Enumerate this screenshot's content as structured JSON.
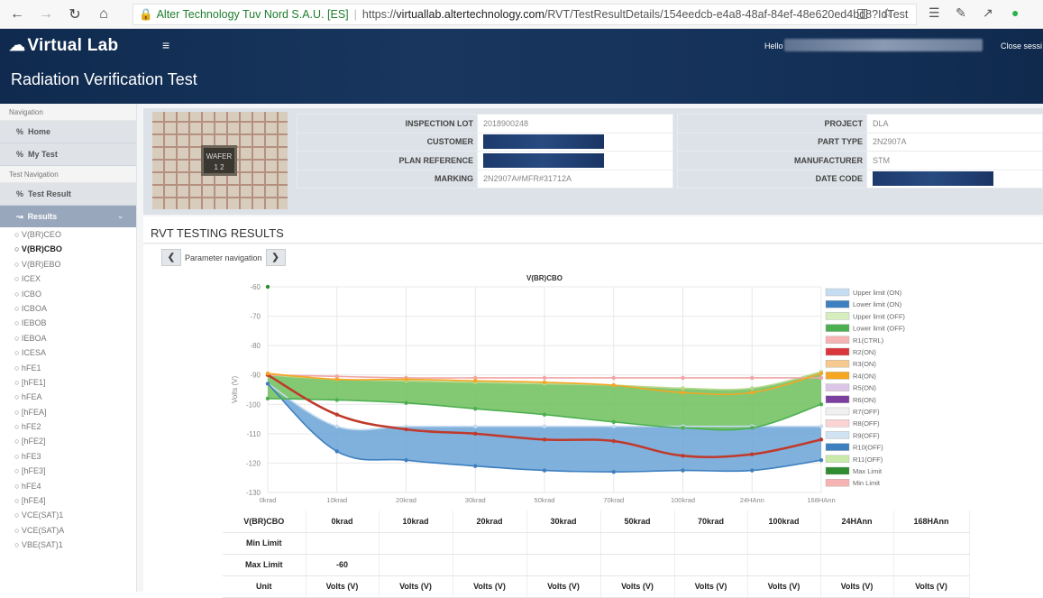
{
  "browser": {
    "site_name": "Alter Technology Tuv Nord S.A.U. [ES]",
    "url_prefix": "https://",
    "url_host": "virtuallab.altertechnology.com",
    "url_path": "/RVT/TestResultDetails/154eedcb-e4a8-48af-84ef-48e620ed4bd8?IdTest"
  },
  "app": {
    "logo": "Virtual Lab",
    "page_title": "Radiation Verification Test",
    "hello": "Hello",
    "close_session": "Close sessi"
  },
  "sidebar": {
    "navigation_label": "Navigation",
    "home": "Home",
    "my_test": "My Test",
    "test_navigation_label": "Test Navigation",
    "test_result": "Test Result",
    "results": "Results",
    "params": [
      "V(BR)CEO",
      "V(BR)CBO",
      "V(BR)EBO",
      "ICEX",
      "ICBO",
      "ICBOA",
      "IEBOB",
      "IEBOA",
      "ICESA",
      "hFE1",
      "[hFE1]",
      "hFEA",
      "[hFEA]",
      "hFE2",
      "[hFE2]",
      "hFE3",
      "[hFE3]",
      "hFE4",
      "[hFE4]",
      "VCE(SAT)1",
      "VCE(SAT)A",
      "VBE(SAT)1"
    ],
    "active_param": "V(BR)CBO"
  },
  "info": {
    "sample_label": "WAFER 1 2",
    "left": [
      {
        "label": "INSPECTION LOT",
        "value": "2018900248"
      },
      {
        "label": "CUSTOMER",
        "value": ""
      },
      {
        "label": "PLAN REFERENCE",
        "value": ""
      },
      {
        "label": "MARKING",
        "value": "2N2907A#MFR#31712A"
      }
    ],
    "right": [
      {
        "label": "PROJECT",
        "value": "DLA"
      },
      {
        "label": "PART TYPE",
        "value": "2N2907A"
      },
      {
        "label": "MANUFACTURER",
        "value": "STM"
      },
      {
        "label": "DATE CODE",
        "value": ""
      }
    ]
  },
  "results": {
    "title": "RVT TESTING RESULTS",
    "param_nav_label": "Parameter navigation"
  },
  "colors": {
    "header_bg": "#15325a",
    "sidebar_results_bg": "#98a7bb",
    "upper_on": "#c6dcf0",
    "lower_on": "#3d7fc0",
    "upper_off": "#d6eebb",
    "lower_off": "#4caf50",
    "max_limit": "#2e8b2e",
    "min_limit": "#f6b3b3"
  },
  "chart_data": {
    "type": "area",
    "title": "V(BR)CBO",
    "ylabel": "Volts (V)",
    "xlabel": "",
    "x": [
      "0krad",
      "10krad",
      "20krad",
      "30krad",
      "50krad",
      "70krad",
      "100krad",
      "24HAnn",
      "168HAnn"
    ],
    "ylim": [
      -130,
      -60
    ],
    "yticks": [
      -60,
      -70,
      -80,
      -90,
      -100,
      -110,
      -120,
      -130
    ],
    "grid": true,
    "legend_position": "right",
    "legend": [
      "Upper limit (ON)",
      "Lower limit (ON)",
      "Upper limit (OFF)",
      "Lower limit (OFF)",
      "R1(CTRL)",
      "R2(ON)",
      "R3(ON)",
      "R4(ON)",
      "R5(ON)",
      "R6(ON)",
      "R7(OFF)",
      "R8(OFF)",
      "R9(OFF)",
      "R10(OFF)",
      "R11(OFF)",
      "Max Limit",
      "Min Limit"
    ],
    "legend_colors": [
      "#c6dcf0",
      "#3d7fc0",
      "#d6eebb",
      "#4caf50",
      "#f6b3b3",
      "#d9363e",
      "#f6c98f",
      "#f5a623",
      "#dcc6e6",
      "#7b3fa0",
      "#f0f0f0",
      "#fbd3d3",
      "#cfe3f3",
      "#3d7fc0",
      "#c9eaa8",
      "#2e8b2e",
      "#f6b3b3"
    ],
    "series": [
      {
        "name": "Upper limit (ON)",
        "values": [
          -93,
          -107.5,
          -107.5,
          -107.5,
          -107.5,
          -107.5,
          -107.5,
          -107.5,
          -107.5
        ],
        "color": "#c6dcf0"
      },
      {
        "name": "Lower limit (ON)",
        "values": [
          -93,
          -116,
          -119,
          -121,
          -122.5,
          -123,
          -122.5,
          -122.5,
          -119
        ],
        "color": "#3d7fc0"
      },
      {
        "name": "Upper limit (OFF)",
        "values": [
          -90,
          -91.5,
          -92,
          -92.5,
          -93,
          -93.5,
          -94.5,
          -94.5,
          -89
        ],
        "color": "#b8d98c"
      },
      {
        "name": "Lower limit (OFF)",
        "values": [
          -98,
          -98.5,
          -99.5,
          -101.5,
          -103.5,
          -106,
          -108,
          -108,
          -100
        ],
        "color": "#4caf50"
      },
      {
        "name": "R1(CTRL)",
        "values": [
          -90,
          -90.5,
          -91,
          -91,
          -91,
          -91,
          -91,
          -91,
          -91
        ],
        "color": "#f0a5a5"
      },
      {
        "name": "R2(ON)",
        "values": [
          -90,
          -103.5,
          -108.5,
          -110,
          -112,
          -112.5,
          -117.5,
          -117,
          -112
        ],
        "color": "#c0392b"
      },
      {
        "name": "R4(ON)",
        "values": [
          -89.5,
          -91.5,
          -91.5,
          -92,
          -92.5,
          -93.5,
          -96,
          -96,
          -89.5
        ],
        "color": "#f5a623"
      },
      {
        "name": "Max Limit",
        "values": [
          -60,
          null,
          null,
          null,
          null,
          null,
          null,
          null,
          null
        ],
        "color": "#2e8b2e"
      }
    ]
  },
  "table": {
    "header": [
      "V(BR)CBO",
      "0krad",
      "10krad",
      "20krad",
      "30krad",
      "50krad",
      "70krad",
      "100krad",
      "24HAnn",
      "168HAnn"
    ],
    "rows": [
      [
        "Min Limit",
        "",
        "",
        "",
        "",
        "",
        "",
        "",
        "",
        ""
      ],
      [
        "Max Limit",
        "-60",
        "",
        "",
        "",
        "",
        "",
        "",
        "",
        ""
      ],
      [
        "Unit",
        "Volts (V)",
        "Volts (V)",
        "Volts (V)",
        "Volts (V)",
        "Volts (V)",
        "Volts (V)",
        "Volts (V)",
        "Volts (V)",
        "Volts (V)"
      ]
    ]
  }
}
